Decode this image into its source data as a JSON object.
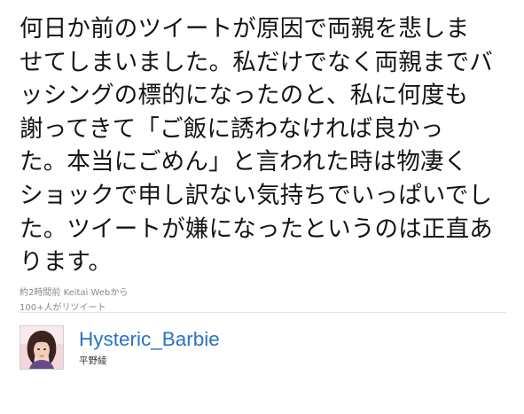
{
  "tweet": {
    "lines": [
      "何日か前のツイートが原因で両親を悲しま",
      "せてしまいました。私だけでなく両親までバ",
      "ッシングの標的になったのと、私に何度も",
      "謝ってきて「ご飯に誘わなければ良かっ",
      "た。本当にごめん」と言われた時は物凄く",
      "ショックで申し訳ない気持ちでいっぱいでし",
      "た。ツイートが嫌になったというのは正直あ",
      "ります。"
    ],
    "timestamp": "約2時間前",
    "source": "Keitai Web",
    "source_suffix": "から",
    "retweets": "100+人がリツイート"
  },
  "author": {
    "screen_name": "Hysteric_Barbie",
    "real_name": "平野綾",
    "avatar_icon": "user-avatar-icon"
  },
  "colors": {
    "text": "#141414",
    "meta": "#8a8a8a",
    "link": "#2a72c4",
    "divider": "#e4e4e4"
  }
}
